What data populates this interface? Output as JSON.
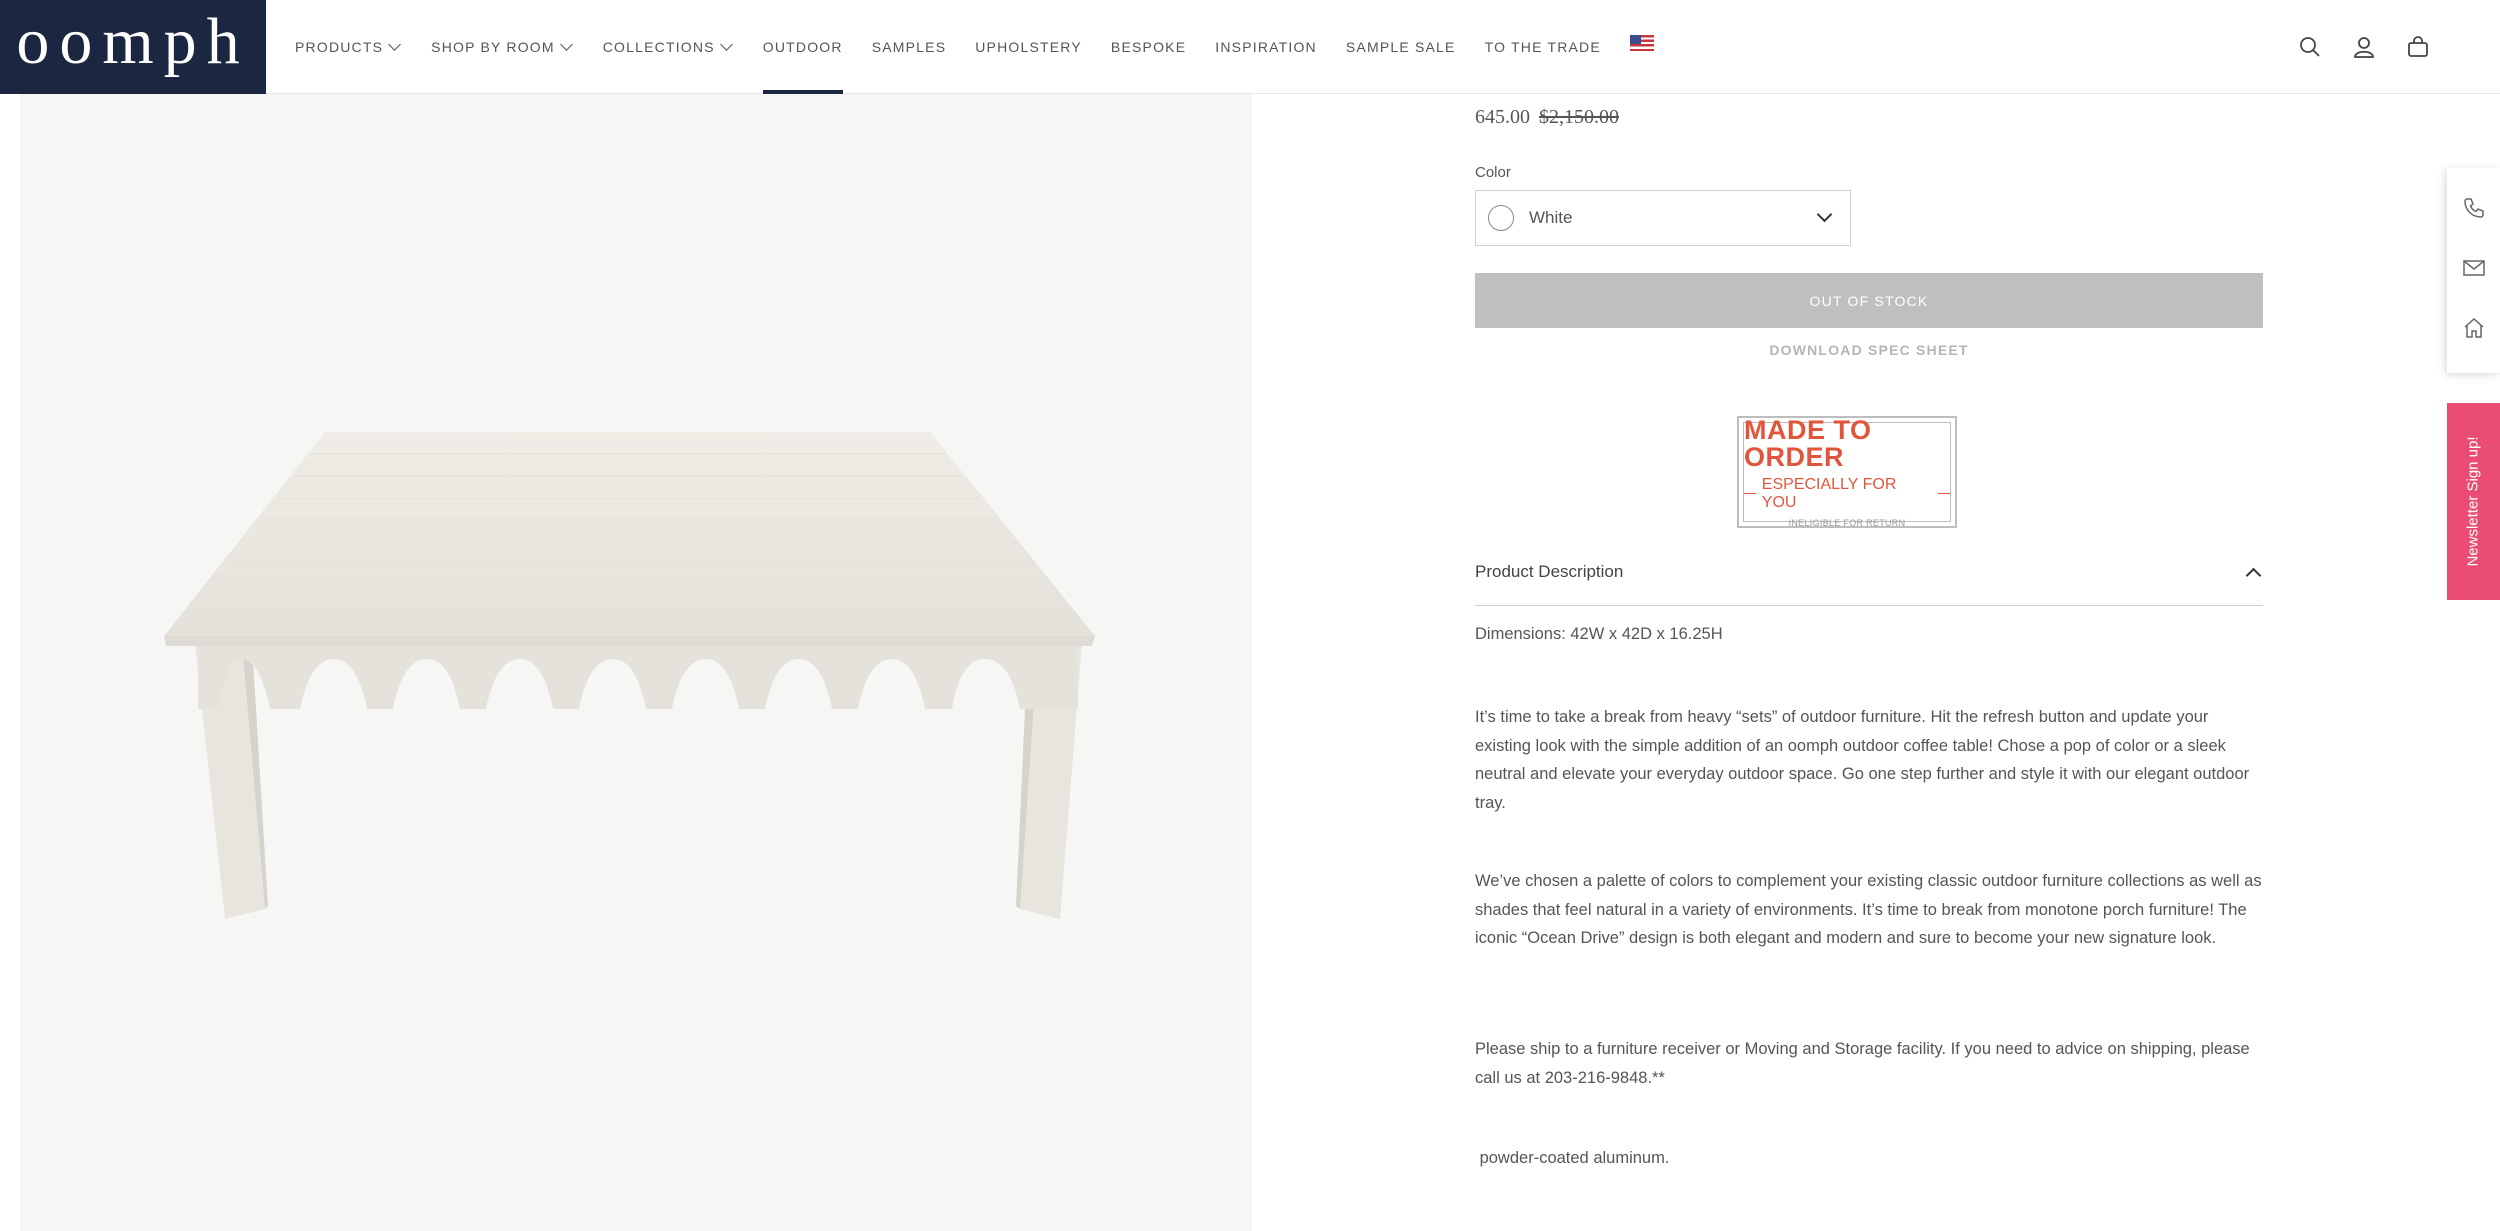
{
  "brand": {
    "logo_text": "oomph",
    "navy": "#1b2640",
    "accent_pink": "#ea4c73",
    "badge_red": "#e2553d"
  },
  "nav": {
    "items": [
      {
        "label": "PRODUCTS",
        "has_dropdown": true
      },
      {
        "label": "SHOP BY ROOM",
        "has_dropdown": true
      },
      {
        "label": "COLLECTIONS",
        "has_dropdown": true
      },
      {
        "label": "OUTDOOR",
        "active": true
      },
      {
        "label": "SAMPLES"
      },
      {
        "label": "UPHOLSTERY"
      },
      {
        "label": "BESPOKE"
      },
      {
        "label": "INSPIRATION"
      },
      {
        "label": "SAMPLE SALE"
      },
      {
        "label": "TO THE TRADE"
      }
    ],
    "flag_icon": "us-flag-icon",
    "header_icons": [
      "search-icon",
      "account-icon",
      "cart-icon"
    ]
  },
  "product": {
    "price_current": "645.00",
    "price_original": "$2,150.00",
    "color_label": "Color",
    "color_value": "White",
    "out_of_stock_label": "OUT OF STOCK",
    "spec_sheet_label": "DOWNLOAD SPEC SHEET",
    "badge": {
      "line1": "MADE TO ORDER",
      "line2": "ESPECIALLY FOR YOU",
      "line3": "INELIGIBLE FOR RETURN"
    },
    "description_title": "Product Description",
    "dimensions": "Dimensions: 42W x 42D x 16.25H",
    "paragraph1": "It’s time to take a break from heavy “sets” of outdoor furniture. Hit the refresh button and update your existing look with the simple addition of an oomph outdoor coffee table! Chose a pop of color or a sleek neutral and elevate your everyday outdoor space. Go one step further and style it with our elegant outdoor tray.",
    "paragraph2": "We’ve chosen a palette of colors to complement your existing classic outdoor furniture collections as well as shades that feel natural in a variety of environments. It’s time to break from monotone porch furniture! The iconic “Ocean Drive” design is both elegant and modern and sure to become your new signature look.",
    "paragraph3": "Please ship to a furniture receiver or Moving and Storage facility. If you need to advice on shipping, please call us at 203-216-9848.**",
    "material": " powder-coated aluminum."
  },
  "side_panel": {
    "icons": [
      "phone-icon",
      "mail-icon",
      "home-icon"
    ],
    "newsletter_label": "Newsletter Sign up!"
  }
}
